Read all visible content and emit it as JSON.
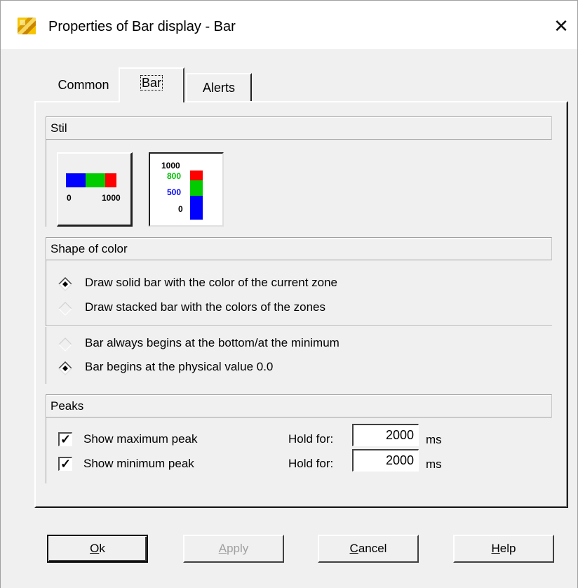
{
  "window": {
    "title": "Properties of Bar display - Bar",
    "close": "✕"
  },
  "tabs": [
    {
      "label": "Common",
      "active": false
    },
    {
      "label": "Bar",
      "active": true
    },
    {
      "label": "Alerts",
      "active": false
    }
  ],
  "stil": {
    "header": "Stil",
    "horizontal_icon": {
      "min_label": "0",
      "max_label": "1000",
      "selected": false
    },
    "vertical_icon": {
      "labels": [
        "1000",
        "800",
        "500",
        "0"
      ],
      "selected": true
    }
  },
  "shape_of_color": {
    "header": "Shape of color",
    "options_fill": [
      {
        "label": "Draw solid bar with the color of the current zone",
        "selected": true
      },
      {
        "label": "Draw stacked bar with the colors of the zones",
        "selected": false
      }
    ],
    "options_origin": [
      {
        "label": "Bar always begins at the bottom/at the minimum",
        "selected": false
      },
      {
        "label": "Bar begins at the physical value 0.0",
        "selected": true
      }
    ]
  },
  "peaks": {
    "header": "Peaks",
    "rows": [
      {
        "label": "Show maximum peak",
        "checked": true,
        "check_mark": "✓",
        "hold_label": "Hold for:",
        "value": "2000",
        "unit": "ms"
      },
      {
        "label": "Show minimum peak",
        "checked": true,
        "check_mark": "✓",
        "hold_label": "Hold for:",
        "value": "2000",
        "unit": "ms"
      }
    ]
  },
  "buttons": {
    "ok": {
      "u": "O",
      "rest": "k"
    },
    "apply": {
      "u": "A",
      "rest": "pply"
    },
    "cancel": {
      "u": "C",
      "rest": "ancel"
    },
    "help": {
      "u": "H",
      "rest": "elp"
    }
  },
  "colors": {
    "zone_low": "#0000ff",
    "zone_mid": "#00cc00",
    "zone_high": "#ff0000",
    "label_mid": "#00c000",
    "label_low": "#0000ff"
  }
}
